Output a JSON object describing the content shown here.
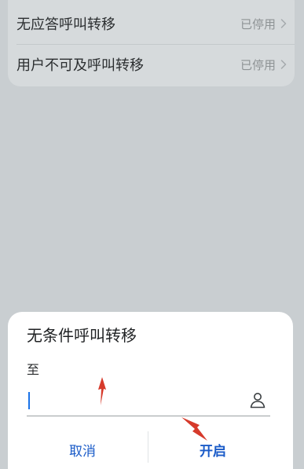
{
  "settings_list": {
    "items": [
      {
        "label": "无应答呼叫转移",
        "status": "已停用"
      },
      {
        "label": "用户不可及呼叫转移",
        "status": "已停用"
      }
    ]
  },
  "dialog": {
    "title": "无条件呼叫转移",
    "to_label": "至",
    "input": {
      "value": "",
      "placeholder": ""
    },
    "contact_icon": "contact-person-icon",
    "cancel_label": "取消",
    "confirm_label": "开启"
  },
  "annotations": {
    "arrow_color": "#d63a2b"
  },
  "colors": {
    "accent": "#1a5bc8",
    "caret": "#1a73e8",
    "overlay": "#c9ced1"
  }
}
